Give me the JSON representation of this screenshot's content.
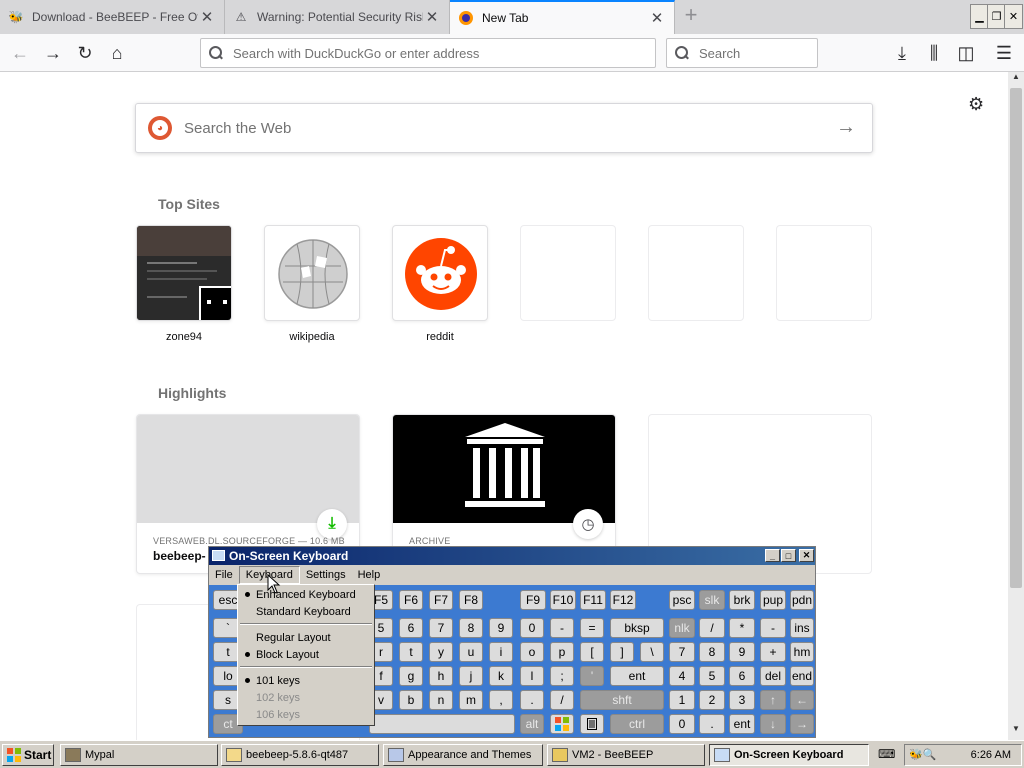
{
  "browser": {
    "tabs": [
      {
        "label": "Download - BeeBEEP - Free Office",
        "icon": "bee-icon"
      },
      {
        "label": "Warning: Potential Security Risk A",
        "icon": "warning-icon"
      },
      {
        "label": "New Tab",
        "icon": "firefox-icon"
      }
    ],
    "new_tab_glyph": "+",
    "url_placeholder": "Search with DuckDuckGo or enter address",
    "search_placeholder": "Search"
  },
  "newtab": {
    "websearch_placeholder": "Search the Web",
    "top_sites_heading": "Top Sites",
    "top_sites": [
      {
        "label": "zone94"
      },
      {
        "label": "wikipedia"
      },
      {
        "label": "reddit"
      },
      {
        "label": ""
      },
      {
        "label": ""
      },
      {
        "label": ""
      }
    ],
    "highlights_heading": "Highlights",
    "highlights": [
      {
        "source": "VERSAWEB.DL.SOURCEFORGE — 10.6 MB",
        "title": "beebeep-"
      },
      {
        "source": "ARCHIVE",
        "title": ""
      }
    ]
  },
  "osk": {
    "title": "On-Screen Keyboard",
    "menu": [
      "File",
      "Keyboard",
      "Settings",
      "Help"
    ],
    "keyboard_menu": {
      "items": [
        {
          "label": "Enhanced Keyboard",
          "checked": true,
          "disabled": false
        },
        {
          "label": "Standard Keyboard",
          "checked": false,
          "disabled": false
        },
        {
          "label": "Regular Layout",
          "checked": false,
          "disabled": false
        },
        {
          "label": "Block Layout",
          "checked": true,
          "disabled": false
        },
        {
          "label": "101 keys",
          "checked": true,
          "disabled": false
        },
        {
          "label": "102 keys",
          "checked": false,
          "disabled": true
        },
        {
          "label": "106 keys",
          "checked": false,
          "disabled": true
        }
      ]
    },
    "rows": [
      [
        "esc",
        "F5",
        "F6",
        "F7",
        "F8",
        "F9",
        "F10",
        "F11",
        "F12",
        "psc",
        "slk",
        "brk",
        "pup",
        "pdn"
      ],
      [
        "`",
        "5",
        "6",
        "7",
        "8",
        "9",
        "0",
        "-",
        "=",
        "bksp",
        "nlk",
        "/",
        "*",
        "-",
        "ins"
      ],
      [
        "t",
        "r",
        "t",
        "y",
        "u",
        "i",
        "o",
        "p",
        "[",
        "]",
        "\\",
        "7",
        "8",
        "9",
        "+",
        "hm"
      ],
      [
        "lo",
        "f",
        "g",
        "h",
        "j",
        "k",
        "l",
        ";",
        "'",
        "ent",
        "4",
        "5",
        "6",
        "del",
        "end"
      ],
      [
        "s",
        "v",
        "b",
        "n",
        "m",
        ",",
        ".",
        "/",
        "shft",
        "1",
        "2",
        "3",
        "↑",
        "←"
      ],
      [
        "ct",
        "alt",
        "ctrl",
        "0",
        ".",
        "ent",
        "↓",
        "→"
      ]
    ]
  },
  "taskbar": {
    "start": "Start",
    "items": [
      {
        "label": "Mypal"
      },
      {
        "label": "beebeep-5.8.6-qt487"
      },
      {
        "label": "Appearance and Themes"
      },
      {
        "label": "VM2 - BeeBEEP"
      },
      {
        "label": "On-Screen Keyboard"
      }
    ],
    "clock": "6:26 AM"
  }
}
